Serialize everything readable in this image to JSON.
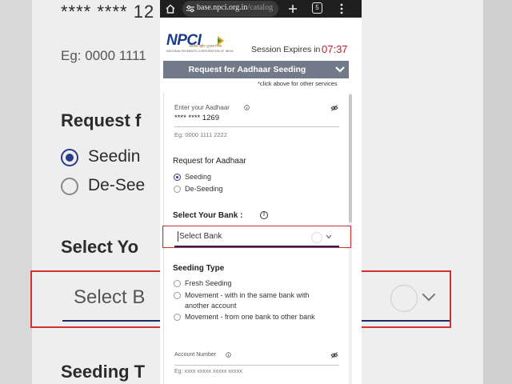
{
  "background": {
    "stars": "**** **** 12",
    "eg": "Eg: 0000 1111",
    "request": "Request f",
    "seeding": "Seedin",
    "deseeding": "De-See",
    "select_your": "Select Yo",
    "select_bank": "Select B",
    "seeding_type": "Seeding T"
  },
  "browser": {
    "url_domain": "base.npci.org.in",
    "url_path": "/catalog",
    "tab_count": "5"
  },
  "header": {
    "logo_text": "NPCI",
    "logo_hindi": "भारतीय राष्ट्रीय भुगतान निगम",
    "logo_english": "NATIONAL PAYMENTS CORPORATION OF INDIA",
    "session_label": "Session Expires in",
    "session_time": "07:37"
  },
  "service": {
    "title": "Request for Aadhaar Seeding",
    "hint": "*click above for other services"
  },
  "form": {
    "aadhaar_label": "Enter your Aadhaar",
    "aadhaar_value": "**** **** 1269",
    "aadhaar_hint": "Eg: 0000 1111 2222",
    "request_title": "Request for Aadhaar",
    "request_options": [
      "Seeding",
      "De-Seeding"
    ],
    "bank_title": "Select Your Bank :",
    "bank_placeholder": "Select Bank",
    "seeding_type_title": "Seeding Type",
    "seeding_type_options": [
      "Fresh Seeding",
      "Movement - with in the same bank with",
      "another account",
      "Movement - from one bank to other bank"
    ],
    "account_label": "Account Number",
    "account_hint": "Eg: xxxx xxxxx xxxxx xxxxx"
  },
  "colors": {
    "accent": "#1b3b8f",
    "highlight": "#d03030",
    "service_bar": "#727a89",
    "timer": "#c0202a"
  }
}
